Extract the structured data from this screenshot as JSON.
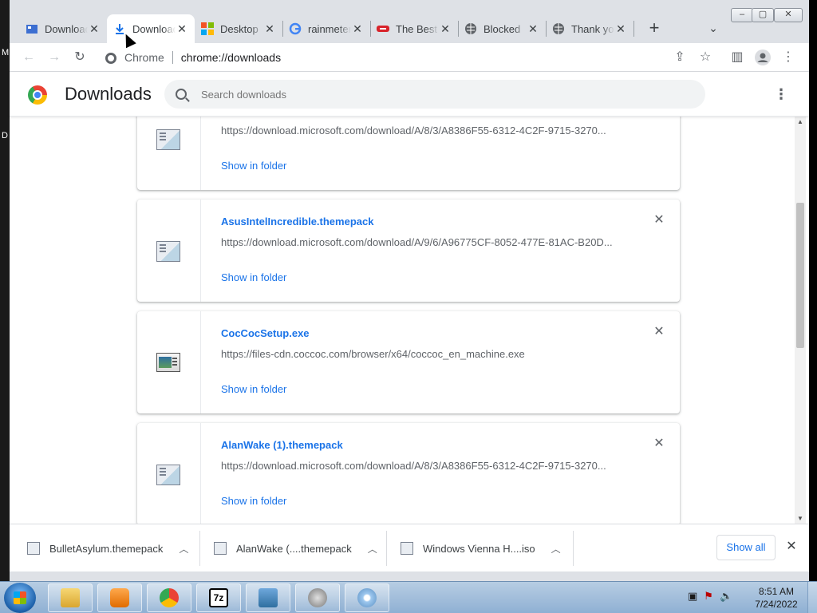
{
  "desktop": {
    "edge_labels": [
      "M",
      "D"
    ]
  },
  "tabs": [
    {
      "title": "Downloads",
      "icon": "app-icon",
      "active": false
    },
    {
      "title": "Downloads",
      "icon": "download-icon",
      "active": true
    },
    {
      "title": "Desktop",
      "icon": "microsoft-icon",
      "active": false
    },
    {
      "title": "rainmeter",
      "icon": "google-icon",
      "active": false
    },
    {
      "title": "The Best",
      "icon": "site-icon",
      "active": false
    },
    {
      "title": "Blocked",
      "icon": "globe-icon",
      "active": false
    },
    {
      "title": "Thank you",
      "icon": "globe-icon",
      "active": false
    }
  ],
  "toolbar": {
    "chip": "Chrome",
    "url": "chrome://downloads"
  },
  "header": {
    "title": "Downloads",
    "search_placeholder": "Search downloads"
  },
  "downloads": [
    {
      "name": "",
      "url": "https://download.microsoft.com/download/A/8/3/A8386F55-6312-4C2F-9715-3270...",
      "action": "Show in folder",
      "icon": "themepack-file-icon"
    },
    {
      "name": "AsusIntelIncredible.themepack",
      "url": "https://download.microsoft.com/download/A/9/6/A96775CF-8052-477E-81AC-B20D...",
      "action": "Show in folder",
      "icon": "themepack-file-icon"
    },
    {
      "name": "CocCocSetup.exe",
      "url": "https://files-cdn.coccoc.com/browser/x64/coccoc_en_machine.exe",
      "action": "Show in folder",
      "icon": "exe-file-icon"
    },
    {
      "name": "AlanWake (1).themepack",
      "url": "https://download.microsoft.com/download/A/8/3/A8386F55-6312-4C2F-9715-3270...",
      "action": "Show in folder",
      "icon": "themepack-file-icon"
    }
  ],
  "shelf": {
    "items": [
      {
        "label": "BulletAsylum.themepack"
      },
      {
        "label": "AlanWake (....themepack"
      },
      {
        "label": "Windows Vienna H....iso"
      }
    ],
    "show_all": "Show all"
  },
  "taskbar": {
    "time": "8:51 AM",
    "date": "7/24/2022"
  },
  "colors": {
    "link": "#1a73e8",
    "tabstrip": "#dee1e6",
    "taskbar": "#a8c2de"
  }
}
